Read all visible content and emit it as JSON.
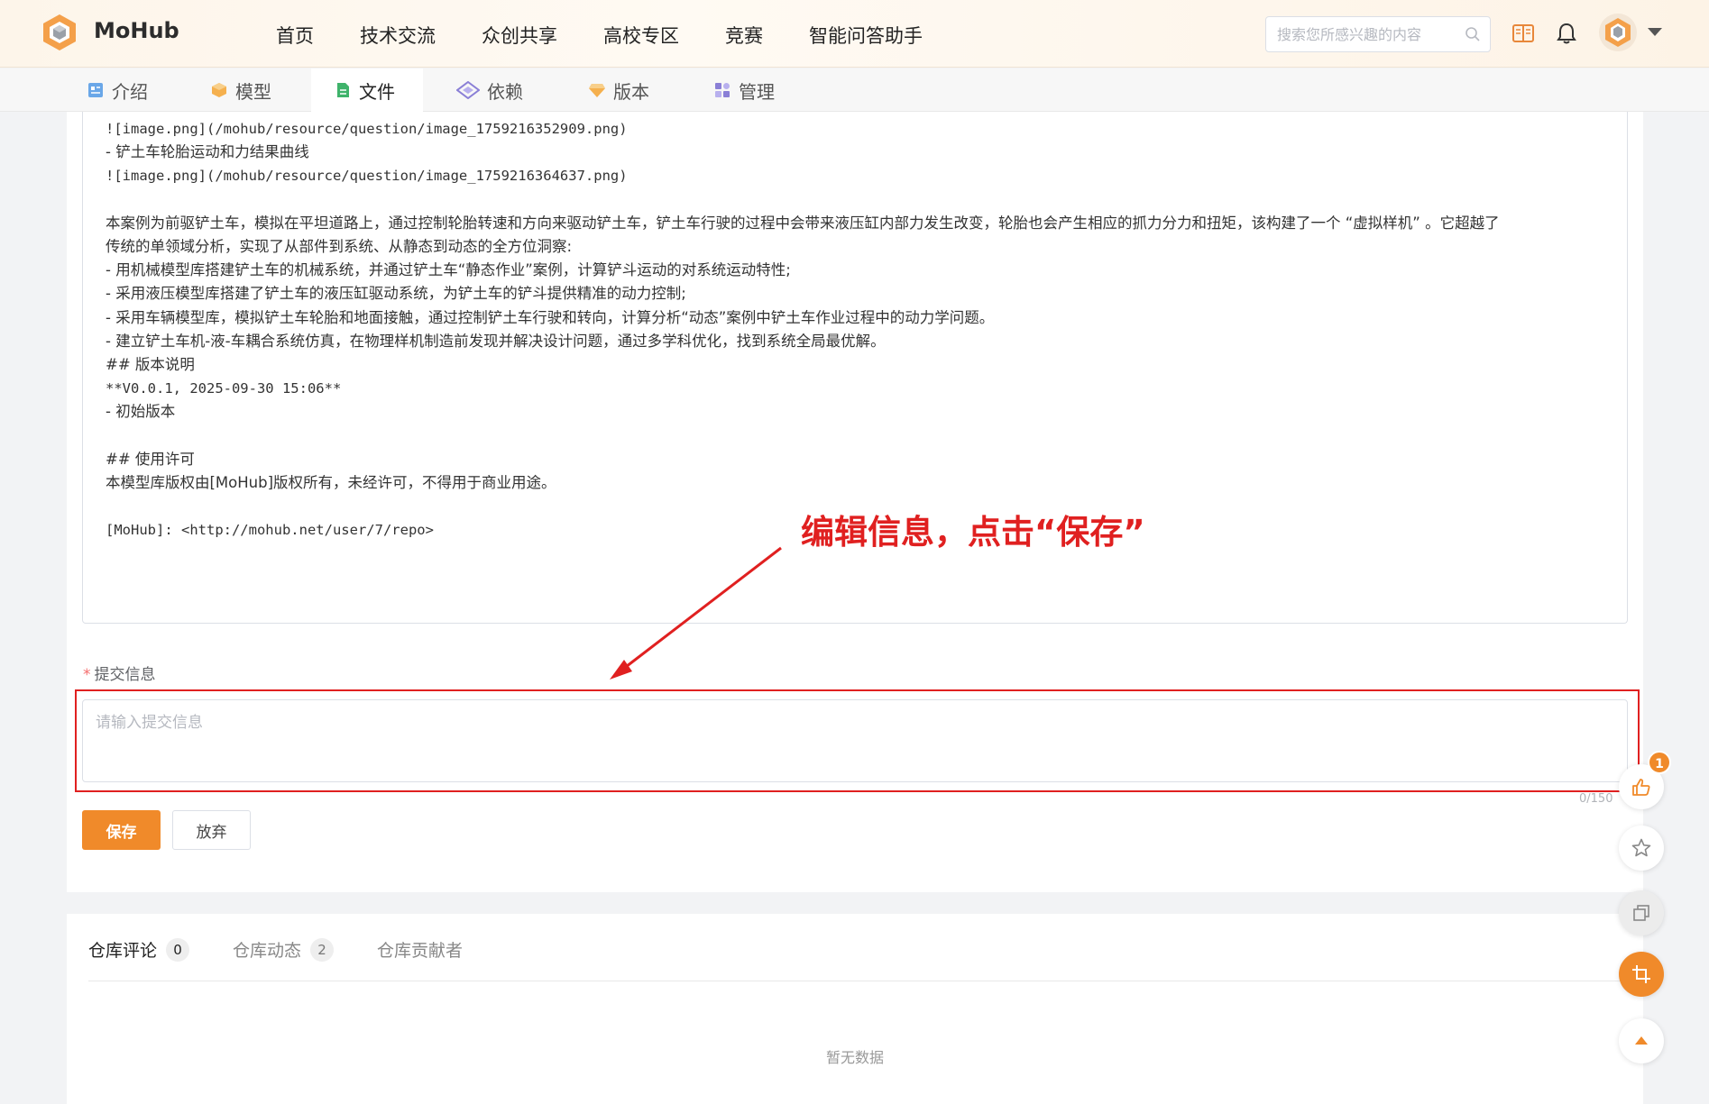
{
  "header": {
    "brand": "MoHub",
    "nav": [
      "首页",
      "技术交流",
      "众创共享",
      "高校专区",
      "竞赛",
      "智能问答助手"
    ],
    "search_placeholder": "搜索您所感兴趣的内容"
  },
  "tabs": [
    {
      "label": "介绍",
      "icon": "doc-icon"
    },
    {
      "label": "模型",
      "icon": "cube-icon"
    },
    {
      "label": "文件",
      "icon": "file-icon",
      "active": true
    },
    {
      "label": "依赖",
      "icon": "diamond-icon"
    },
    {
      "label": "版本",
      "icon": "gem-icon"
    },
    {
      "label": "管理",
      "icon": "grid-icon"
    }
  ],
  "editor": {
    "lines": [
      {
        "text": "![image.png](/mohub/resource/question/image_1759216352909.png)",
        "mono": true
      },
      {
        "text": "- 铲土车轮胎运动和力结果曲线",
        "mono": false
      },
      {
        "text": "![image.png](/mohub/resource/question/image_1759216364637.png)",
        "mono": true
      },
      {
        "text": "",
        "mono": false
      },
      {
        "text": "本案例为前驱铲土车，模拟在平坦道路上，通过控制轮胎转速和方向来驱动铲土车，铲土车行驶的过程中会带来液压缸内部力发生改变，轮胎也会产生相应的抓力分力和扭矩，该构建了一个 “虚拟样机” 。它超越了",
        "mono": false
      },
      {
        "text": "传统的单领域分析，实现了从部件到系统、从静态到动态的全方位洞察:",
        "mono": false
      },
      {
        "text": "- 用机械模型库搭建铲土车的机械系统，并通过铲土车“静态作业”案例，计算铲斗运动的对系统运动特性;",
        "mono": false
      },
      {
        "text": "- 采用液压模型库搭建了铲土车的液压缸驱动系统，为铲土车的铲斗提供精准的动力控制;",
        "mono": false
      },
      {
        "text": "- 采用车辆模型库，模拟铲土车轮胎和地面接触，通过控制铲土车行驶和转向，计算分析“动态”案例中铲土车作业过程中的动力学问题。",
        "mono": false
      },
      {
        "text": "- 建立铲土车机-液-车耦合系统仿真，在物理样机制造前发现并解决设计问题，通过多学科优化，找到系统全局最优解。",
        "mono": false
      },
      {
        "text": "## 版本说明",
        "mono": false
      },
      {
        "text": "**V0.0.1, 2025-09-30 15:06**",
        "mono": true
      },
      {
        "text": "- 初始版本",
        "mono": false
      },
      {
        "text": "",
        "mono": false
      },
      {
        "text": "## 使用许可",
        "mono": false
      },
      {
        "text": "本模型库版权由[MoHub]版权所有，未经许可，不得用于商业用途。",
        "mono": false
      },
      {
        "text": "",
        "mono": false
      },
      {
        "text": "[MoHub]: <http://mohub.net/user/7/repo>",
        "mono": true
      }
    ]
  },
  "form": {
    "submit_label": "提交信息",
    "required_mark": "*",
    "submit_placeholder": "请输入提交信息",
    "submit_value": "",
    "counter": "0/150",
    "save_label": "保存",
    "cancel_label": "放弃"
  },
  "annotation": {
    "text": "编辑信息，点击“保存”",
    "color": "#e02020"
  },
  "bottom_tabs": [
    {
      "label": "仓库评论",
      "count": "0",
      "active": true
    },
    {
      "label": "仓库动态",
      "count": "2",
      "active": false
    },
    {
      "label": "仓库贡献者",
      "count": null,
      "active": false
    }
  ],
  "empty_text": "暂无数据",
  "float": {
    "like_badge": "1"
  },
  "colors": {
    "accent": "#f08a2a",
    "annotation": "#e02020"
  }
}
